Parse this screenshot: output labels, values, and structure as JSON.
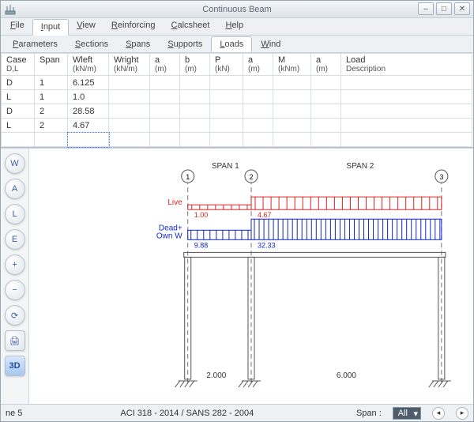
{
  "window": {
    "title": "Continuous Beam"
  },
  "menu": {
    "items": [
      "File",
      "Input",
      "View",
      "Reinforcing",
      "Calcsheet",
      "Help"
    ],
    "active": "Input"
  },
  "subtabs": {
    "items": [
      "Parameters",
      "Sections",
      "Spans",
      "Supports",
      "Loads",
      "Wind"
    ],
    "active": "Loads"
  },
  "table": {
    "headers": [
      {
        "t": "Case",
        "s": "D,L"
      },
      {
        "t": "Span",
        "s": ""
      },
      {
        "t": "Wleft",
        "s": "(kN/m)"
      },
      {
        "t": "Wright",
        "s": "(kN/m)"
      },
      {
        "t": "a",
        "s": "(m)"
      },
      {
        "t": "b",
        "s": "(m)"
      },
      {
        "t": "P",
        "s": "(kN)"
      },
      {
        "t": "a",
        "s": "(m)"
      },
      {
        "t": "M",
        "s": "(kNm)"
      },
      {
        "t": "a",
        "s": "(m)"
      },
      {
        "t": "Load",
        "s": "Description"
      }
    ],
    "rows": [
      {
        "c": "D",
        "span": "1",
        "wleft": "6.125"
      },
      {
        "c": "L",
        "span": "1",
        "wleft": "1.0"
      },
      {
        "c": "D",
        "span": "2",
        "wleft": "28.58"
      },
      {
        "c": "L",
        "span": "2",
        "wleft": "4.67"
      },
      {
        "c": "",
        "span": "",
        "wleft": ""
      }
    ]
  },
  "tools": [
    "W",
    "A",
    "L",
    "E",
    "+",
    "−",
    "⟳",
    "🖨",
    "3D"
  ],
  "diagram": {
    "span1_label": "SPAN 1",
    "span2_label": "SPAN 2",
    "node1": "1",
    "node2": "2",
    "node3": "3",
    "live_label": "Live",
    "dead_label_l1": "Dead+",
    "dead_label_l2": "Own W",
    "live_v1": "1.00",
    "live_v2": "4.67",
    "dead_v1": "9.88",
    "dead_v2": "32.33",
    "dim1": "2.000",
    "dim2": "6.000"
  },
  "status": {
    "left": "ne 5",
    "mid": "ACI 318 - 2014    / SANS 282 - 2004",
    "span_label": "Span :",
    "span_value": "All"
  },
  "colors": {
    "red": "#d92626",
    "blue": "#1028c8",
    "text_blue": "#2a52d6"
  }
}
